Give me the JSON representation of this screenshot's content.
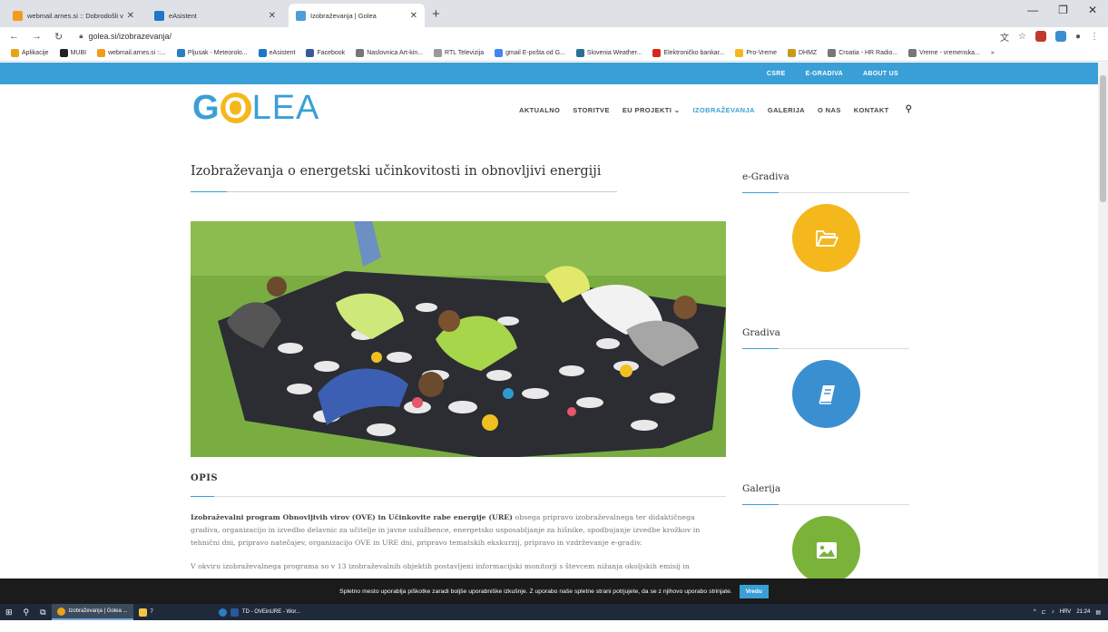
{
  "browser": {
    "tabs": [
      {
        "title": "webmail.arnes.si :: Dobrodošli v ...",
        "color": "#f29c1f",
        "active": false
      },
      {
        "title": "eAsistent",
        "color": "#1f77c9",
        "active": false
      },
      {
        "title": "Izobraževanja | Golea",
        "color": "#4a9fd6",
        "active": true
      }
    ],
    "new_tab": "+",
    "url": "golea.si/izobrazevanja/",
    "bookmarks": [
      "Aplikacije",
      "MUBI",
      "webmail.arnes.si ::...",
      "Pljusak - Meteorolo...",
      "eAsistent",
      "Facebook",
      "Naslovnica Art-kin...",
      "RTL Televizija",
      "gmail E-pošta od G...",
      "Slovenia Weather...",
      "Elektroničko bankar...",
      "Pro-Vreme",
      "DHMZ",
      "Croatia - HR Radio...",
      "Vreme - vremenska..."
    ],
    "more_bookmarks": "»"
  },
  "site": {
    "top_links": [
      "CSRE",
      "E-GRADIVA",
      "ABOUT US"
    ],
    "logo": {
      "g": "G",
      "o": "O",
      "lea": "LEA"
    },
    "nav": [
      {
        "label": "AKTUALNO",
        "active": false
      },
      {
        "label": "STORITVE",
        "active": false
      },
      {
        "label": "EU PROJEKTI ⌄",
        "active": false
      },
      {
        "label": "IZOBRAŽEVANJA",
        "active": true
      },
      {
        "label": "GALERIJA",
        "active": false
      },
      {
        "label": "O NAS",
        "active": false
      },
      {
        "label": "KONTAKT",
        "active": false
      }
    ],
    "page_title": "Izobraževanja o energetski učinkovitosti in obnovljivi energiji",
    "section_heading": "OPIS",
    "para1_bold": "Izobraževalni program Obnovljivih virov (OVE) in Učinkovite rabe energije (URE)",
    "para1_rest": " obsega pripravo izobraževalnega ter didaktičnega gradiva, organizacijo in izvedbo delavnic za učitelje in javne uslužbence, energetsko usposabljanje za hišnike, spodbujanje izvedbe krožkov in tehnični dni, pripravo natečajev, organizacijo OVE in URE dni, pripravo tematskih ekskurzij, pripravo in vzdrževanje e-gradiv.",
    "para2": "V okviru izobraževalnega programa so v 13 izobraževalnih objektih postavljeni informacijski monitorji s števcem nižanja okoljskih emisij in",
    "sidebar": [
      {
        "title": "e-Gradiva",
        "icon": "folder-icon",
        "color": "#f4b81d"
      },
      {
        "title": "Gradiva",
        "icon": "book-icon",
        "color": "#3a8fd0"
      },
      {
        "title": "Galerija",
        "icon": "image-icon",
        "color": "#7bb33a"
      }
    ]
  },
  "cookie": {
    "text": "Spletno mesto uporablja piškotke zaradi boljše uporabniške izkušnje. Z uporabo naše spletne strani potrjujete, da se z njihovo uporabo strinjate.",
    "button": "Vredu"
  },
  "taskbar": {
    "items": [
      "Izobraževanja | Golea ...",
      "7",
      "TD - OVEinURE - Wor..."
    ],
    "lang": "HRV",
    "time": "21:24"
  }
}
